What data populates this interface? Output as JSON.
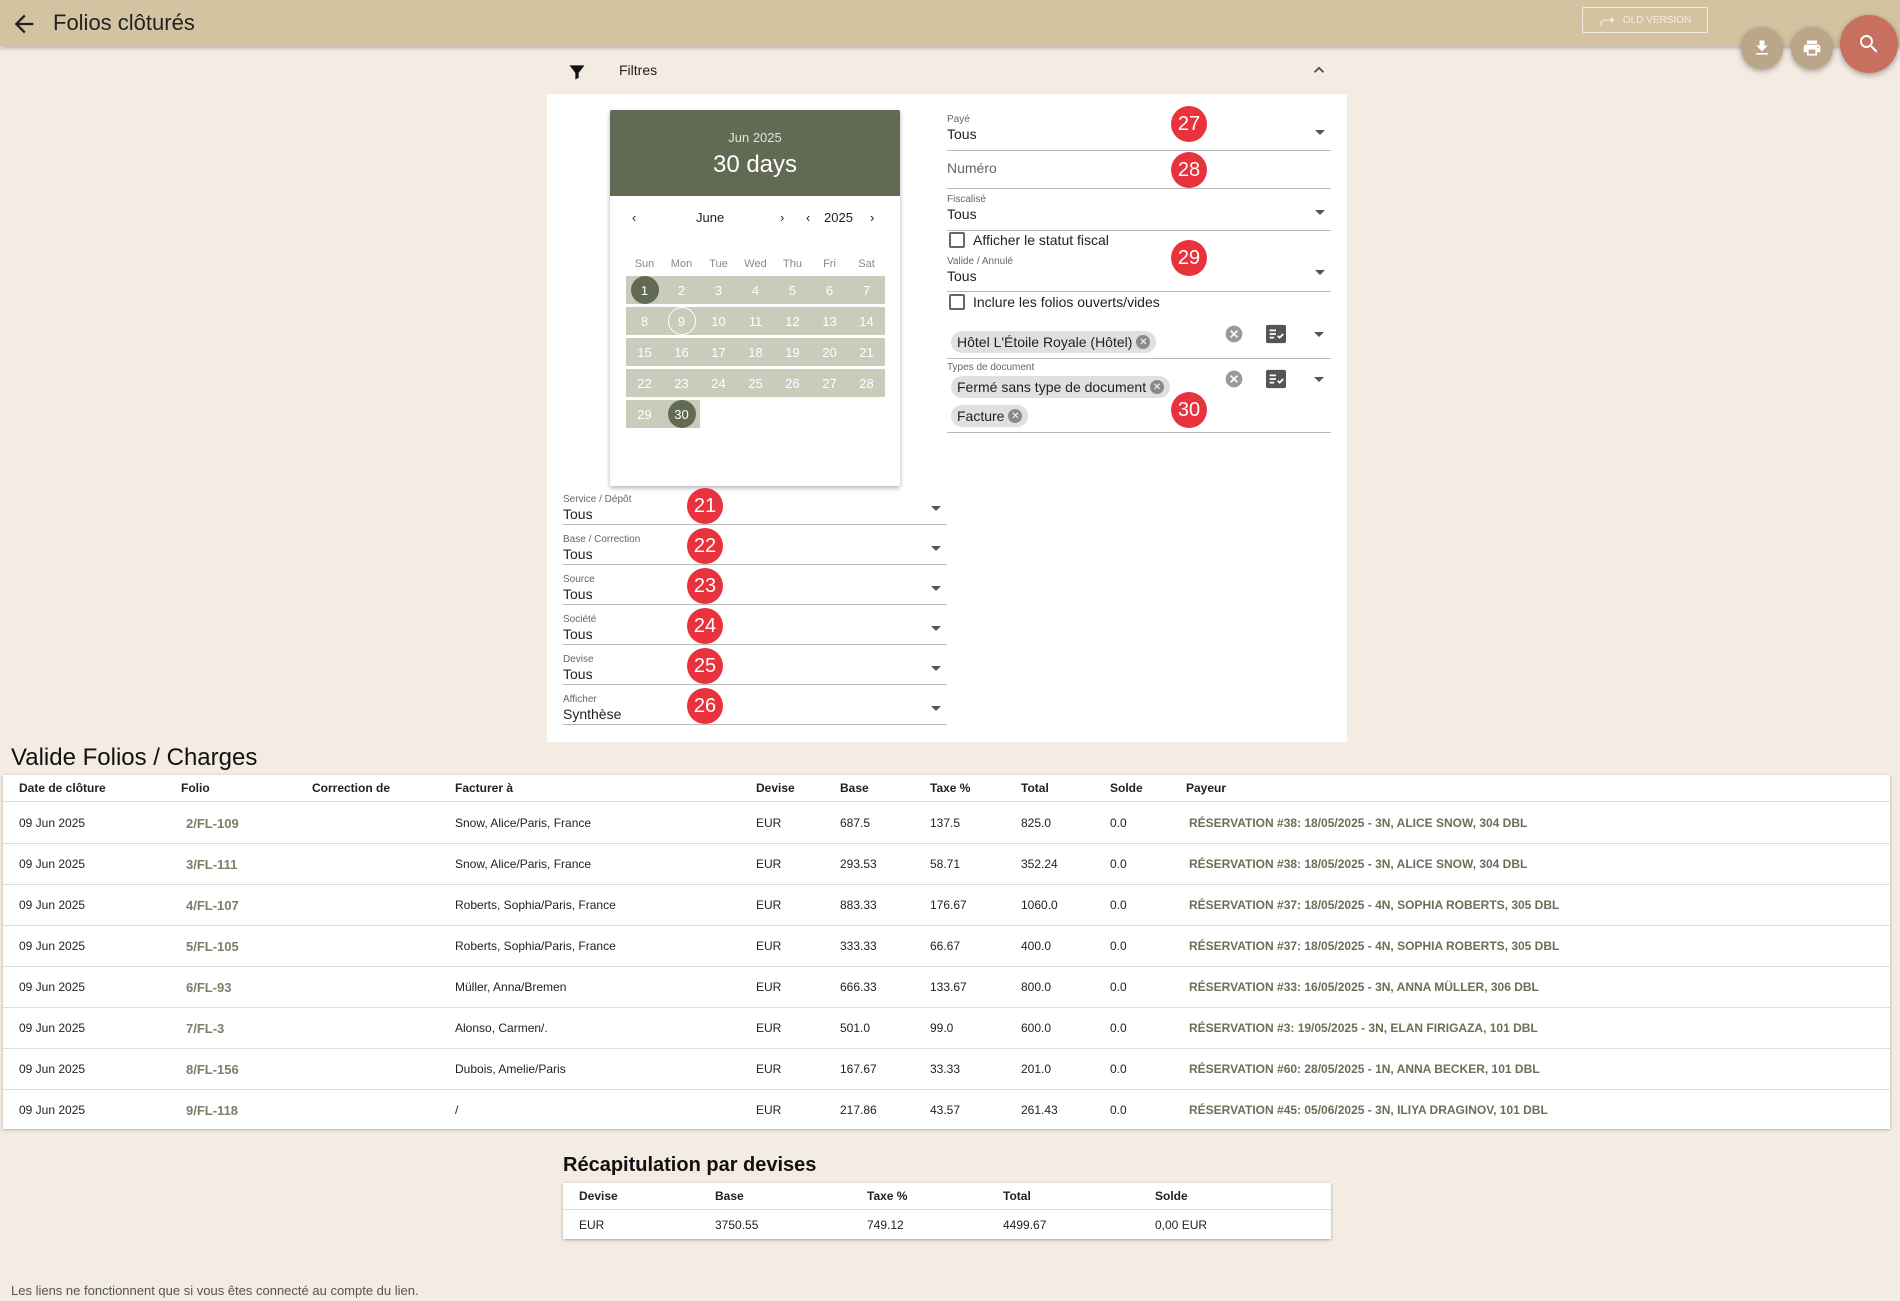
{
  "header": {
    "title": "Folios clôturés",
    "old_version_label": "OLD VERSION"
  },
  "filters": {
    "label": "Filtres",
    "calendar": {
      "month_year": "Jun 2025",
      "range_label": "30 days",
      "month": "June",
      "year": "2025",
      "weekdays": [
        "Sun",
        "Mon",
        "Tue",
        "Wed",
        "Thu",
        "Fri",
        "Sat"
      ],
      "weeks": [
        [
          "1",
          "2",
          "3",
          "4",
          "5",
          "6",
          "7"
        ],
        [
          "8",
          "9",
          "10",
          "11",
          "12",
          "13",
          "14"
        ],
        [
          "15",
          "16",
          "17",
          "18",
          "19",
          "20",
          "21"
        ],
        [
          "22",
          "23",
          "24",
          "25",
          "26",
          "27",
          "28"
        ],
        [
          "29",
          "30",
          "",
          "",
          "",
          "",
          ""
        ]
      ],
      "selected_start": "1",
      "selected_end": "30",
      "today": "9"
    },
    "left_fields": [
      {
        "label": "Service / Dépôt",
        "value": "Tous",
        "badge": "21"
      },
      {
        "label": "Base / Correction",
        "value": "Tous",
        "badge": "22"
      },
      {
        "label": "Source",
        "value": "Tous",
        "badge": "23"
      },
      {
        "label": "Société",
        "value": "Tous",
        "badge": "24"
      },
      {
        "label": "Devise",
        "value": "Tous",
        "badge": "25"
      },
      {
        "label": "Afficher",
        "value": "Synthèse",
        "badge": "26"
      }
    ],
    "paye": {
      "label": "Payé",
      "value": "Tous",
      "badge": "27"
    },
    "numero": {
      "placeholder": "Numéro",
      "badge": "28"
    },
    "fiscalise": {
      "label": "Fiscalisé",
      "value": "Tous"
    },
    "afficher_statut_fiscal": "Afficher le statut fiscal",
    "valide_annule": {
      "label": "Valide / Annulé",
      "value": "Tous",
      "badge": "29"
    },
    "inclure_ouverts": "Inclure les folios ouverts/vides",
    "hotel_chip": "Hôtel L'Étoile Royale (Hôtel)",
    "types_document": {
      "label": "Types de document",
      "chips": [
        "Fermé sans type de document",
        "Facture"
      ],
      "badge": "30"
    }
  },
  "table": {
    "title": "Valide Folios / Charges",
    "columns": [
      "Date de clôture",
      "Folio",
      "Correction de",
      "Facturer à",
      "Devise",
      "Base",
      "Taxe %",
      "Total",
      "Solde",
      "Payeur"
    ],
    "rows": [
      {
        "date": "09 Jun 2025",
        "folio": "2/FL-109",
        "correction": "",
        "facturer": "Snow, Alice/Paris, France",
        "devise": "EUR",
        "base": "687.5",
        "taxe": "137.5",
        "total": "825.0",
        "solde": "0.0",
        "payeur": "RÉSERVATION #38: 18/05/2025 - 3N, ALICE SNOW, 304 DBL"
      },
      {
        "date": "09 Jun 2025",
        "folio": "3/FL-111",
        "correction": "",
        "facturer": "Snow, Alice/Paris, France",
        "devise": "EUR",
        "base": "293.53",
        "taxe": "58.71",
        "total": "352.24",
        "solde": "0.0",
        "payeur": "RÉSERVATION #38: 18/05/2025 - 3N, ALICE SNOW, 304 DBL"
      },
      {
        "date": "09 Jun 2025",
        "folio": "4/FL-107",
        "correction": "",
        "facturer": "Roberts, Sophia/Paris, France",
        "devise": "EUR",
        "base": "883.33",
        "taxe": "176.67",
        "total": "1060.0",
        "solde": "0.0",
        "payeur": "RÉSERVATION #37: 18/05/2025 - 4N, SOPHIA ROBERTS, 305 DBL"
      },
      {
        "date": "09 Jun 2025",
        "folio": "5/FL-105",
        "correction": "",
        "facturer": "Roberts, Sophia/Paris, France",
        "devise": "EUR",
        "base": "333.33",
        "taxe": "66.67",
        "total": "400.0",
        "solde": "0.0",
        "payeur": "RÉSERVATION #37: 18/05/2025 - 4N, SOPHIA ROBERTS, 305 DBL"
      },
      {
        "date": "09 Jun 2025",
        "folio": "6/FL-93",
        "correction": "",
        "facturer": "Müller, Anna/Bremen",
        "devise": "EUR",
        "base": "666.33",
        "taxe": "133.67",
        "total": "800.0",
        "solde": "0.0",
        "payeur": "RÉSERVATION #33: 16/05/2025 - 3N, ANNA MÜLLER, 306 DBL"
      },
      {
        "date": "09 Jun 2025",
        "folio": "7/FL-3",
        "correction": "",
        "facturer": "Alonso, Carmen/.",
        "devise": "EUR",
        "base": "501.0",
        "taxe": "99.0",
        "total": "600.0",
        "solde": "0.0",
        "payeur": "RÉSERVATION #3: 19/05/2025 - 3N, ELAN FIRIGAZA, 101 DBL"
      },
      {
        "date": "09 Jun 2025",
        "folio": "8/FL-156",
        "correction": "",
        "facturer": "Dubois, Amelie/Paris",
        "devise": "EUR",
        "base": "167.67",
        "taxe": "33.33",
        "total": "201.0",
        "solde": "0.0",
        "payeur": "RÉSERVATION #60: 28/05/2025 - 1N, ANNA BECKER, 101 DBL"
      },
      {
        "date": "09 Jun 2025",
        "folio": "9/FL-118",
        "correction": "",
        "facturer": "/",
        "devise": "EUR",
        "base": "217.86",
        "taxe": "43.57",
        "total": "261.43",
        "solde": "0.0",
        "payeur": "RÉSERVATION #45: 05/06/2025 - 3N, ILIYA DRAGINOV, 101 DBL"
      }
    ]
  },
  "recap": {
    "title": "Récapitulation par devises",
    "columns": [
      "Devise",
      "Base",
      "Taxe %",
      "Total",
      "Solde"
    ],
    "row": {
      "devise": "EUR",
      "base": "3750.55",
      "taxe": "749.12",
      "total": "4499.67",
      "solde": "0,00 EUR"
    }
  },
  "footer_note": "Les liens ne fonctionnent que si vous êtes connecté au compte du lien.",
  "colors": {
    "topbar": "#d3c3a1",
    "accent": "#636a53",
    "badge": "#e8323c",
    "search_fab": "#c8705f"
  }
}
